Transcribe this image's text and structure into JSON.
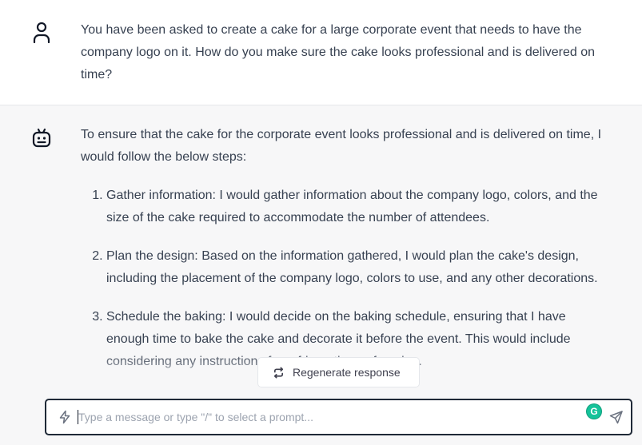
{
  "user_message": {
    "avatar_icon": "user-icon",
    "text": "You have been asked to create a cake for a large corporate event that needs to have the company logo on it. How do you make sure the cake looks professional and is delivered on time?"
  },
  "assistant_message": {
    "avatar_icon": "bot-icon",
    "intro": "To ensure that the cake for the corporate event looks professional and is delivered on time, I would follow the below steps:",
    "steps": [
      "Gather information: I would gather information about the company logo, colors, and the size of the cake required to accommodate the number of attendees.",
      "Plan the design: Based on the information gathered, I would plan the cake's design, including the placement of the company logo, colors to use, and any other decorations.",
      "Schedule the baking: I would decide on the baking schedule, ensuring that I have enough time to bake the cake and decorate it before the event. This would include considering any instructions for refrigeration or freezing."
    ]
  },
  "regenerate": {
    "label": "Regenerate response",
    "icon": "regenerate-icon"
  },
  "composer": {
    "placeholder": "Type a message or type \"/\" to select a prompt...",
    "value": "",
    "prompt_icon": "lightning-icon",
    "extension_badge": "G",
    "send_icon": "send-icon"
  },
  "colors": {
    "page_bg": "#ffffff",
    "assistant_bg": "#f7f7f8",
    "text": "#374151",
    "grammarly": "#15c39a"
  }
}
